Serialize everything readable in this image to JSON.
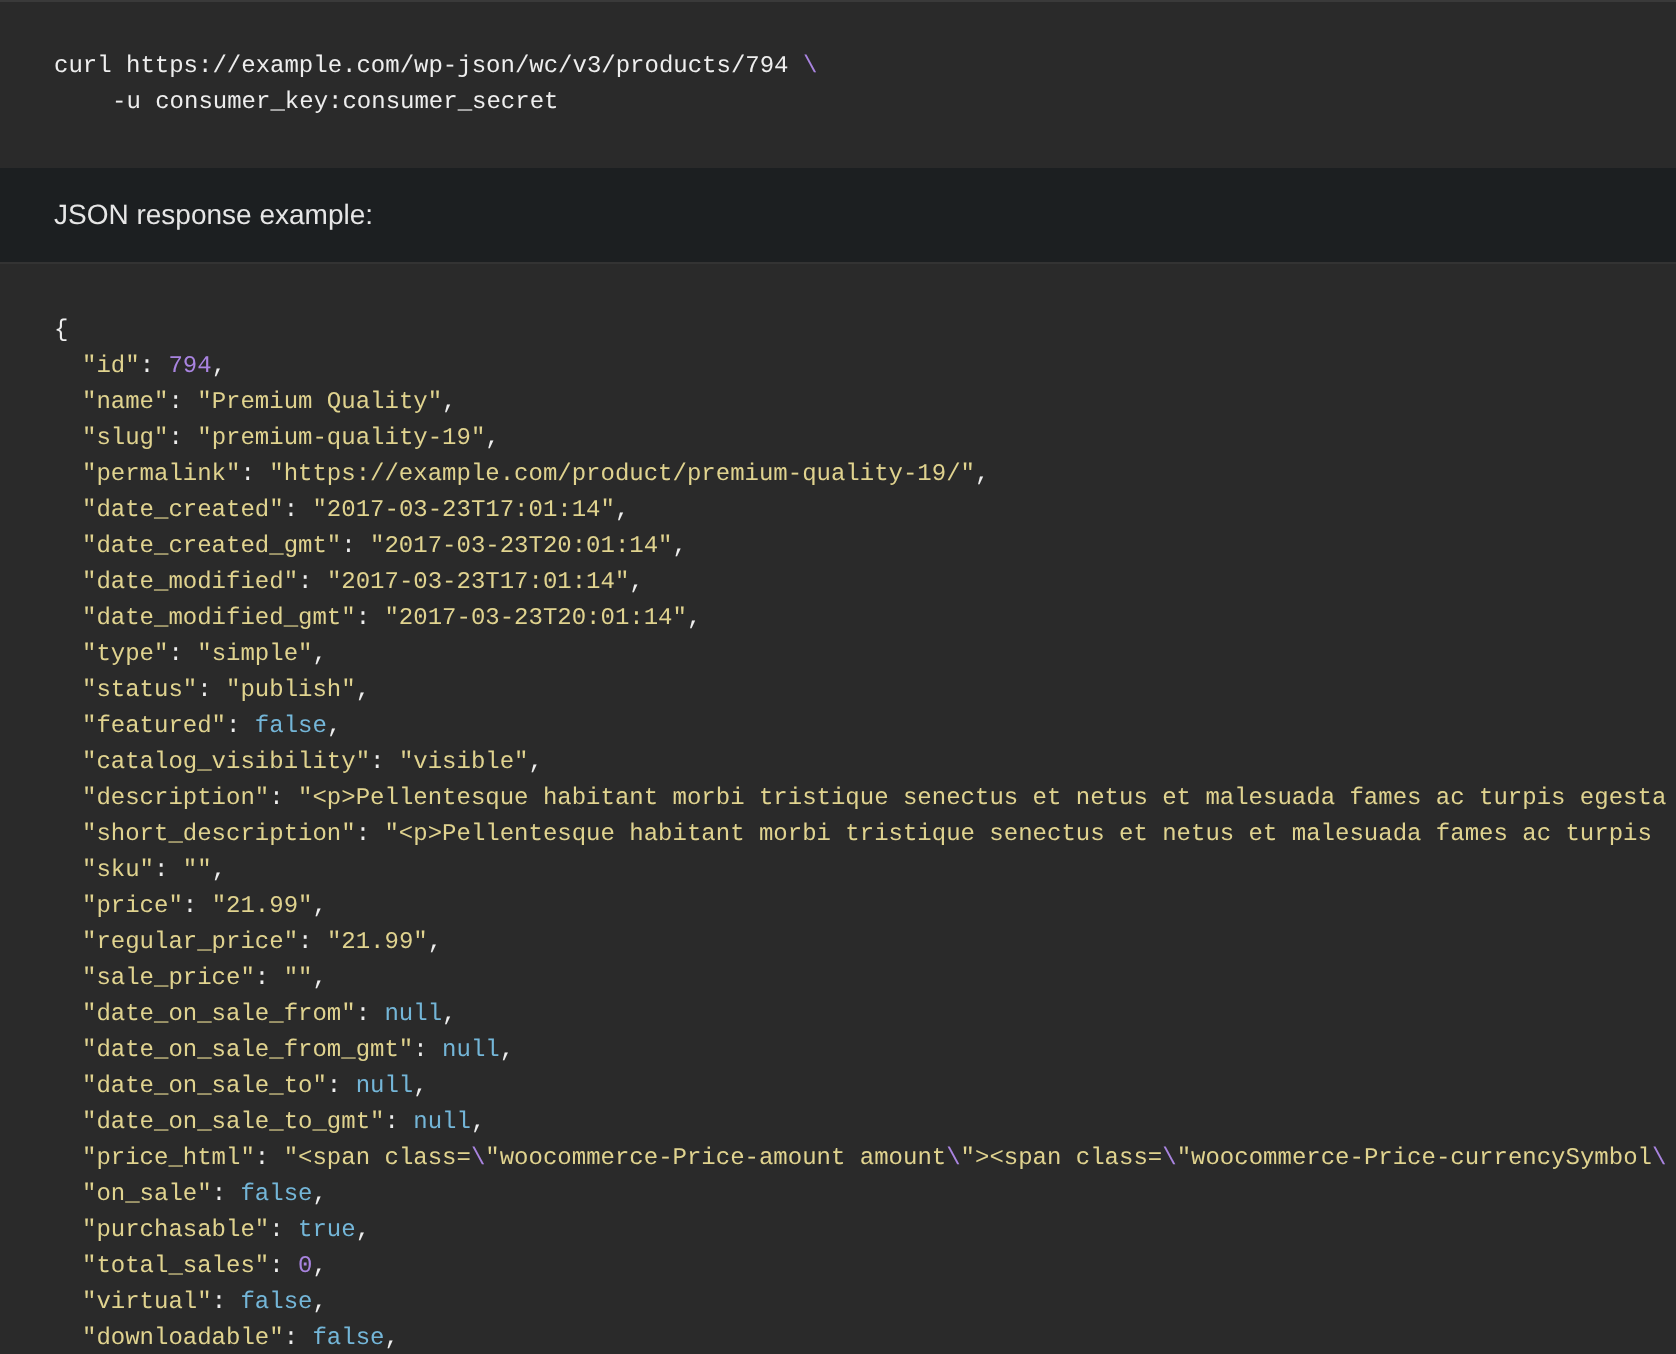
{
  "request": {
    "lines": [
      {
        "continuation": false,
        "tokens": [
          {
            "kind": "plain",
            "text": "curl https://example.com/wp-json/wc/v3/products/794 "
          },
          {
            "kind": "escape",
            "text": "\\"
          }
        ]
      },
      {
        "continuation": true,
        "tokens": [
          {
            "kind": "plain",
            "text": "-u consumer_key:consumer_secret"
          }
        ]
      }
    ]
  },
  "heading": "JSON response example:",
  "response": {
    "open": "{",
    "entries": [
      {
        "key": "\"id\"",
        "sep": ": ",
        "value": [
          {
            "kind": "number",
            "text": "794"
          }
        ],
        "end": ","
      },
      {
        "key": "\"name\"",
        "sep": ": ",
        "value": [
          {
            "kind": "string",
            "text": "\"Premium Quality\""
          }
        ],
        "end": ","
      },
      {
        "key": "\"slug\"",
        "sep": ": ",
        "value": [
          {
            "kind": "string",
            "text": "\"premium-quality-19\""
          }
        ],
        "end": ","
      },
      {
        "key": "\"permalink\"",
        "sep": ": ",
        "value": [
          {
            "kind": "string",
            "text": "\"https://example.com/product/premium-quality-19/\""
          }
        ],
        "end": ","
      },
      {
        "key": "\"date_created\"",
        "sep": ": ",
        "value": [
          {
            "kind": "string",
            "text": "\"2017-03-23T17:01:14\""
          }
        ],
        "end": ","
      },
      {
        "key": "\"date_created_gmt\"",
        "sep": ": ",
        "value": [
          {
            "kind": "string",
            "text": "\"2017-03-23T20:01:14\""
          }
        ],
        "end": ","
      },
      {
        "key": "\"date_modified\"",
        "sep": ": ",
        "value": [
          {
            "kind": "string",
            "text": "\"2017-03-23T17:01:14\""
          }
        ],
        "end": ","
      },
      {
        "key": "\"date_modified_gmt\"",
        "sep": ": ",
        "value": [
          {
            "kind": "string",
            "text": "\"2017-03-23T20:01:14\""
          }
        ],
        "end": ","
      },
      {
        "key": "\"type\"",
        "sep": ": ",
        "value": [
          {
            "kind": "string",
            "text": "\"simple\""
          }
        ],
        "end": ","
      },
      {
        "key": "\"status\"",
        "sep": ": ",
        "value": [
          {
            "kind": "string",
            "text": "\"publish\""
          }
        ],
        "end": ","
      },
      {
        "key": "\"featured\"",
        "sep": ": ",
        "value": [
          {
            "kind": "literal",
            "text": "false"
          }
        ],
        "end": ","
      },
      {
        "key": "\"catalog_visibility\"",
        "sep": ": ",
        "value": [
          {
            "kind": "string",
            "text": "\"visible\""
          }
        ],
        "end": ","
      },
      {
        "key": "\"description\"",
        "sep": ": ",
        "value": [
          {
            "kind": "string",
            "text": "\"<p>Pellentesque habitant morbi tristique senectus et netus et malesuada fames ac turpis egesta"
          }
        ]
      },
      {
        "key": "\"short_description\"",
        "sep": ": ",
        "value": [
          {
            "kind": "string",
            "text": "\"<p>Pellentesque habitant morbi tristique senectus et netus et malesuada fames ac turpis"
          }
        ]
      },
      {
        "key": "\"sku\"",
        "sep": ": ",
        "value": [
          {
            "kind": "string",
            "text": "\"\""
          }
        ],
        "end": ","
      },
      {
        "key": "\"price\"",
        "sep": ": ",
        "value": [
          {
            "kind": "string",
            "text": "\"21.99\""
          }
        ],
        "end": ","
      },
      {
        "key": "\"regular_price\"",
        "sep": ": ",
        "value": [
          {
            "kind": "string",
            "text": "\"21.99\""
          }
        ],
        "end": ","
      },
      {
        "key": "\"sale_price\"",
        "sep": ": ",
        "value": [
          {
            "kind": "string",
            "text": "\"\""
          }
        ],
        "end": ","
      },
      {
        "key": "\"date_on_sale_from\"",
        "sep": ": ",
        "value": [
          {
            "kind": "literal",
            "text": "null"
          }
        ],
        "end": ","
      },
      {
        "key": "\"date_on_sale_from_gmt\"",
        "sep": ": ",
        "value": [
          {
            "kind": "literal",
            "text": "null"
          }
        ],
        "end": ","
      },
      {
        "key": "\"date_on_sale_to\"",
        "sep": ": ",
        "value": [
          {
            "kind": "literal",
            "text": "null"
          }
        ],
        "end": ","
      },
      {
        "key": "\"date_on_sale_to_gmt\"",
        "sep": ": ",
        "value": [
          {
            "kind": "literal",
            "text": "null"
          }
        ],
        "end": ","
      },
      {
        "key": "\"price_html\"",
        "sep": ": ",
        "value": [
          {
            "kind": "string",
            "text": "\"<span class="
          },
          {
            "kind": "escape",
            "text": "\\"
          },
          {
            "kind": "string",
            "text": "\"woocommerce-Price-amount amount"
          },
          {
            "kind": "escape",
            "text": "\\"
          },
          {
            "kind": "string",
            "text": "\"><span class="
          },
          {
            "kind": "escape",
            "text": "\\"
          },
          {
            "kind": "string",
            "text": "\"woocommerce-Price-currencySymbol"
          },
          {
            "kind": "escape",
            "text": "\\"
          }
        ]
      },
      {
        "key": "\"on_sale\"",
        "sep": ": ",
        "value": [
          {
            "kind": "literal",
            "text": "false"
          }
        ],
        "end": ","
      },
      {
        "key": "\"purchasable\"",
        "sep": ": ",
        "value": [
          {
            "kind": "literal",
            "text": "true"
          }
        ],
        "end": ","
      },
      {
        "key": "\"total_sales\"",
        "sep": ": ",
        "value": [
          {
            "kind": "number",
            "text": "0"
          }
        ],
        "end": ","
      },
      {
        "key": "\"virtual\"",
        "sep": ": ",
        "value": [
          {
            "kind": "literal",
            "text": "false"
          }
        ],
        "end": ","
      },
      {
        "key": "\"downloadable\"",
        "sep": ": ",
        "value": [
          {
            "kind": "literal",
            "text": "false"
          }
        ],
        "end": ","
      }
    ]
  }
}
